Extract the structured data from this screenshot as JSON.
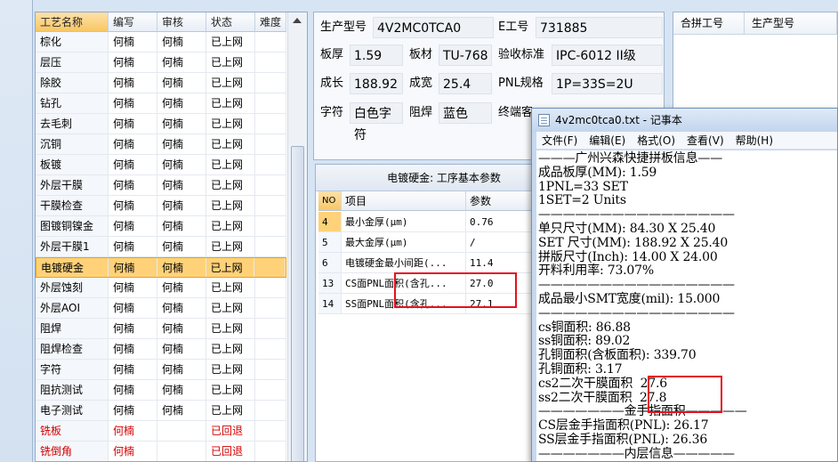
{
  "process_table": {
    "headers": [
      "工艺名称",
      "编写",
      "审核",
      "状态",
      "难度"
    ],
    "rows": [
      {
        "name": "棕化",
        "writer": "何楠",
        "reviewer": "何楠",
        "status": "已上网",
        "difficulty": ""
      },
      {
        "name": "层压",
        "writer": "何楠",
        "reviewer": "何楠",
        "status": "已上网",
        "difficulty": ""
      },
      {
        "name": "除胶",
        "writer": "何楠",
        "reviewer": "何楠",
        "status": "已上网",
        "difficulty": ""
      },
      {
        "name": "钻孔",
        "writer": "何楠",
        "reviewer": "何楠",
        "status": "已上网",
        "difficulty": ""
      },
      {
        "name": "去毛刺",
        "writer": "何楠",
        "reviewer": "何楠",
        "status": "已上网",
        "difficulty": ""
      },
      {
        "name": "沉铜",
        "writer": "何楠",
        "reviewer": "何楠",
        "status": "已上网",
        "difficulty": ""
      },
      {
        "name": "板镀",
        "writer": "何楠",
        "reviewer": "何楠",
        "status": "已上网",
        "difficulty": ""
      },
      {
        "name": "外层干膜",
        "writer": "何楠",
        "reviewer": "何楠",
        "status": "已上网",
        "difficulty": ""
      },
      {
        "name": "干膜检查",
        "writer": "何楠",
        "reviewer": "何楠",
        "status": "已上网",
        "difficulty": ""
      },
      {
        "name": "图镀铜镍金",
        "writer": "何楠",
        "reviewer": "何楠",
        "status": "已上网",
        "difficulty": ""
      },
      {
        "name": "外层干膜1",
        "writer": "何楠",
        "reviewer": "何楠",
        "status": "已上网",
        "difficulty": ""
      },
      {
        "name": "电镀硬金",
        "writer": "何楠",
        "reviewer": "何楠",
        "status": "已上网",
        "difficulty": "",
        "selected": true
      },
      {
        "name": "外层蚀刻",
        "writer": "何楠",
        "reviewer": "何楠",
        "status": "已上网",
        "difficulty": ""
      },
      {
        "name": "外层AOI",
        "writer": "何楠",
        "reviewer": "何楠",
        "status": "已上网",
        "difficulty": ""
      },
      {
        "name": "阻焊",
        "writer": "何楠",
        "reviewer": "何楠",
        "status": "已上网",
        "difficulty": ""
      },
      {
        "name": "阻焊检查",
        "writer": "何楠",
        "reviewer": "何楠",
        "status": "已上网",
        "difficulty": ""
      },
      {
        "name": "字符",
        "writer": "何楠",
        "reviewer": "何楠",
        "status": "已上网",
        "difficulty": ""
      },
      {
        "name": "阻抗测试",
        "writer": "何楠",
        "reviewer": "何楠",
        "status": "已上网",
        "difficulty": ""
      },
      {
        "name": "电子测试",
        "writer": "何楠",
        "reviewer": "何楠",
        "status": "已上网",
        "difficulty": ""
      },
      {
        "name": "铣板",
        "writer": "何楠",
        "reviewer": "",
        "status": "已回退",
        "difficulty": "",
        "returned": true
      },
      {
        "name": "铣倒角",
        "writer": "何楠",
        "reviewer": "",
        "status": "已回退",
        "difficulty": "",
        "returned": true
      }
    ]
  },
  "info": {
    "model_label": "生产型号",
    "model_value": "4V2MC0TCA0",
    "eno_label": "E工号",
    "eno_value": "731885",
    "thickness_label": "板厚",
    "thickness_value": "1.59",
    "material_label": "板材",
    "material_value": "TU-768",
    "standard_label": "验收标准",
    "standard_value": "IPC-6012 II级",
    "length_label": "成长",
    "length_value": "188.92",
    "width_label": "成宽",
    "width_value": "25.4",
    "pnl_label": "PNL规格",
    "pnl_value": "1P=33S=2U",
    "char_label": "字符",
    "char_value": "白色字符",
    "mask_label": "阻焊",
    "mask_value": "蓝色",
    "final_label": "终端客"
  },
  "merge": {
    "headers": [
      "合拼工号",
      "生产型号"
    ]
  },
  "params": {
    "title": "电镀硬金: 工序基本参数",
    "headers": [
      "NO",
      "项目",
      "参数"
    ],
    "rows": [
      {
        "no": "4",
        "item": "最小金厚(μm)",
        "value": "0.76",
        "selected": true
      },
      {
        "no": "5",
        "item": "最大金厚(μm)",
        "value": "/"
      },
      {
        "no": "6",
        "item": "电镀硬金最小间距(...",
        "value": "11.4"
      },
      {
        "no": "13",
        "item": "CS面PNL面积(含孔...",
        "value": "27.0"
      },
      {
        "no": "14",
        "item": "SS面PNL面积(含孔...",
        "value": "27.1"
      }
    ]
  },
  "notepad": {
    "title": "4v2mc0tca0.txt - 记事本",
    "menu": [
      "文件(F)",
      "编辑(E)",
      "格式(O)",
      "查看(V)",
      "帮助(H)"
    ],
    "lines": [
      "———广州兴森快捷拼板信息——",
      "成品板厚(MM): 1.59",
      "1PNL=33 SET",
      "1SET=2 Units",
      "————————————————",
      "单只尺寸(MM): 84.30 X 25.40",
      "SET 尺寸(MM): 188.92 X 25.40",
      "拼版尺寸(Inch): 14.00 X 24.00",
      "开料利用率: 73.07%",
      "————————————————",
      "成品最小SMT宽度(mil): 15.000",
      "————————————————",
      "cs铜面积: 86.88",
      "ss铜面积: 89.02",
      "孔铜面积(含板面积): 339.70",
      "孔铜面积: 3.17",
      "cs2二次干膜面积  27.6",
      "ss2二次干膜面积  27.8",
      "———————金手指面积—————",
      "CS层金手指面积(PNL): 26.17",
      "SS层金手指面积(PNL): 26.36",
      "———————内层信息—————"
    ]
  },
  "colors": {
    "accent_selection": "#ffd27a",
    "returned_status": "#d40000",
    "highlight_box": "#e3121c"
  }
}
